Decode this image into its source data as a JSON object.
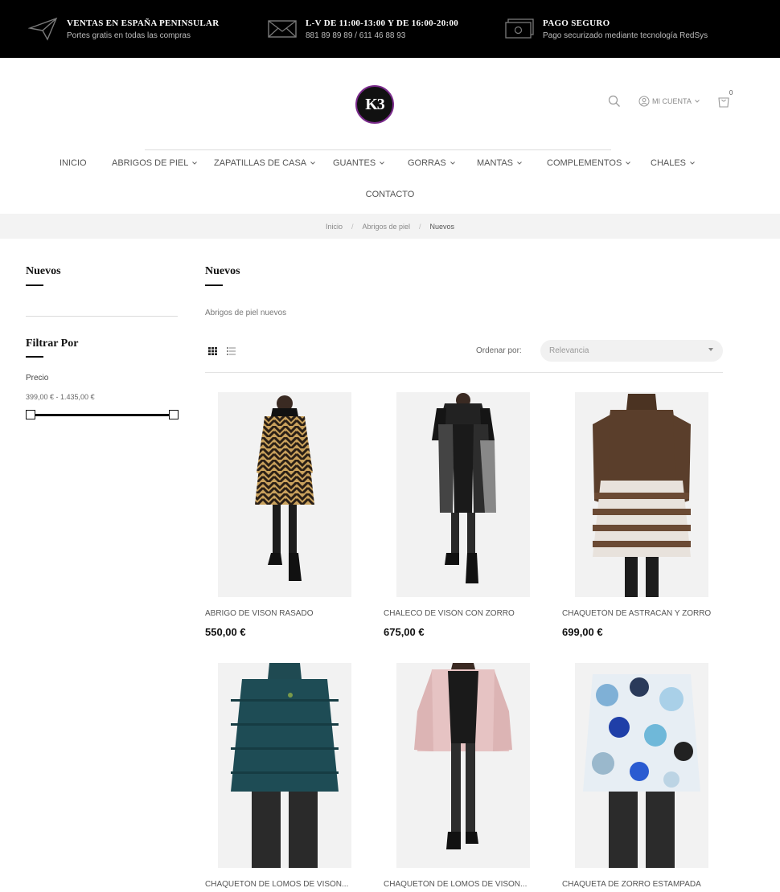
{
  "topbar": {
    "shipping": {
      "title": "VENTAS EN ESPAÑA PENINSULAR",
      "subtitle": "Portes gratis en todas las compras"
    },
    "hours": {
      "title": "L-V DE 11:00-13:00 Y DE 16:00-20:00",
      "subtitle": "881 89 89 89 / 611 46 88 93"
    },
    "payment": {
      "title": "PAGO SEGURO",
      "subtitle": "Pago securizado mediante tecnología RedSys"
    }
  },
  "header": {
    "logo_text": "K3",
    "account_label": "MI CUENTA",
    "cart_count": "0"
  },
  "nav": {
    "items": [
      {
        "label": "INICIO"
      },
      {
        "label": "ABRIGOS DE PIEL"
      },
      {
        "label": "ZAPATILLAS DE CASA"
      },
      {
        "label": "GUANTES"
      },
      {
        "label": "GORRAS"
      },
      {
        "label": "MANTAS"
      },
      {
        "label": "COMPLEMENTOS"
      },
      {
        "label": "CHALES"
      }
    ],
    "contact": "CONTACTO"
  },
  "breadcrumb": [
    "Inicio",
    "Abrigos de piel",
    "Nuevos"
  ],
  "sidebar": {
    "category_title": "Nuevos",
    "filter_title": "Filtrar Por",
    "price_label": "Precio",
    "price_range": "399,00 € - 1.435,00 €"
  },
  "main": {
    "title": "Nuevos",
    "description": "Abrigos de piel nuevos",
    "sort_label": "Ordenar por:",
    "sort_value": "Relevancia"
  },
  "products": [
    {
      "name": "ABRIGO DE VISON RASADO",
      "price": "550,00 €"
    },
    {
      "name": "CHALECO DE VISÓN CON ZORRO",
      "price": "675,00 €"
    },
    {
      "name": "CHAQUETÓN DE ASTRACÁN Y ZORRO",
      "price": "699,00 €"
    },
    {
      "name": "CHAQUETÓN DE LOMOS DE VISÓN...",
      "price": ""
    },
    {
      "name": "CHAQUETÓN DE LOMOS DE VISÓN...",
      "price": ""
    },
    {
      "name": "CHAQUETA DE ZORRO ESTAMPADA",
      "price": ""
    }
  ]
}
